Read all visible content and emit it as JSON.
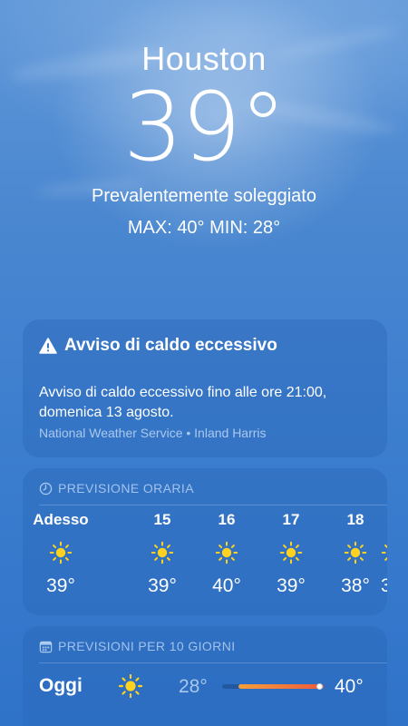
{
  "location": {
    "city": "Houston",
    "temperature": "39°",
    "condition": "Prevalentemente soleggiato",
    "hi_lo": "MAX: 40°  MIN: 28°"
  },
  "alert": {
    "icon": "warning-triangle-icon",
    "title": "Avviso di caldo eccessivo",
    "body": "Avviso di caldo eccessivo fino alle ore 21:00, domenica 13 agosto.",
    "source": "National Weather Service • Inland Harris"
  },
  "hourly": {
    "header_icon": "clock-icon",
    "header": "PREVISIONE ORARIA",
    "items": [
      {
        "label": "Adesso",
        "icon": "sun-icon",
        "temp": "39°"
      },
      {
        "label": "15",
        "icon": "sun-icon",
        "temp": "39°"
      },
      {
        "label": "16",
        "icon": "sun-icon",
        "temp": "40°"
      },
      {
        "label": "17",
        "icon": "sun-icon",
        "temp": "39°"
      },
      {
        "label": "18",
        "icon": "sun-icon",
        "temp": "38°"
      },
      {
        "label": "",
        "icon": "sun-icon",
        "temp": "3"
      }
    ]
  },
  "ten_day": {
    "header_icon": "calendar-icon",
    "header": "PREVISIONI PER 10 GIORNI",
    "days": [
      {
        "day": "Oggi",
        "icon": "sun-icon",
        "min": "28°",
        "max": "40°"
      }
    ]
  },
  "colors": {
    "sun": "#ffd21f",
    "temp_bar_start": "#f4a03a",
    "temp_bar_end": "#ef5a3c"
  }
}
